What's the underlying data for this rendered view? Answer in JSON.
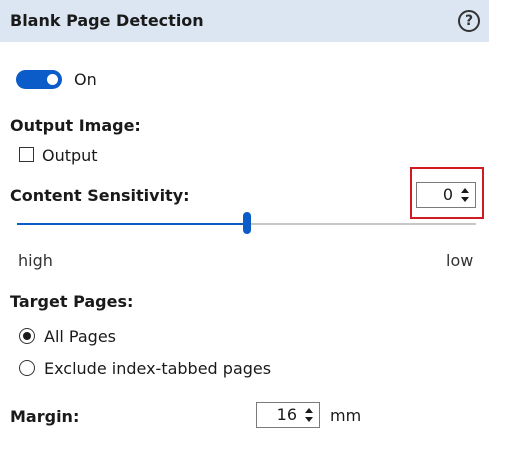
{
  "panel": {
    "title": "Blank Page Detection",
    "help_icon": "?"
  },
  "detection": {
    "enabled": true,
    "state_label": "On"
  },
  "output_image": {
    "label": "Output Image:",
    "checkbox_label": "Output",
    "checked": false
  },
  "content_sensitivity": {
    "label": "Content Sensitivity:",
    "value": "0",
    "slider_level": 0.5,
    "slider_min_label": "high",
    "slider_max_label": "low"
  },
  "target_pages": {
    "label": "Target Pages:",
    "options": [
      {
        "label": "All Pages",
        "selected": true
      },
      {
        "label": "Exclude index-tabbed pages",
        "selected": false
      }
    ]
  },
  "margin": {
    "label": "Margin:",
    "value": "16",
    "unit": "mm"
  },
  "colors": {
    "accent": "#0b5cc9",
    "header_bg": "#dce6f3",
    "highlight": "#d11b22"
  }
}
